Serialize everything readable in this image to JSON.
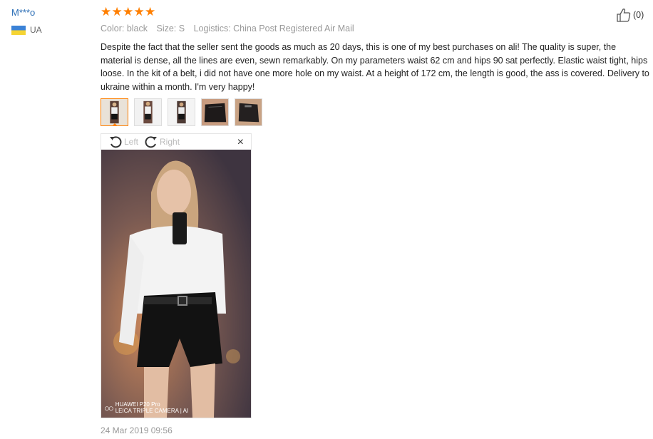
{
  "user": {
    "name": "M***o",
    "country": "UA"
  },
  "rating": {
    "stars": 5,
    "max": 5
  },
  "meta": {
    "color": "Color: black",
    "size": "Size: S",
    "logistics": "Logistics: China Post Registered Air Mail"
  },
  "review": {
    "text": "Despite the fact that the seller sent the goods as much as 20 days, this is one of my best purchases on ali! The quality is super, the material is dense, all the lines are even, sewn remarkably. On my parameters waist 62 cm and hips 90 sat perfectly. Elastic waist tight, hips loose. In the kit of a belt, i did not have one more hole on my waist. At a height of 172 cm, the length is good, the ass is covered. Delivery to ukraine within a month. I'm very happy!"
  },
  "viewer": {
    "rotate_left": "Left",
    "rotate_right": "Right",
    "close": "×",
    "watermark_line1": "HUAWEI P20 Pro",
    "watermark_line2": "LEICA TRIPLE CAMERA | AI"
  },
  "date": "24 Mar 2019 09:56",
  "helpful": {
    "count": "(0)"
  },
  "icons": {
    "star": "star-icon",
    "thumb": "thumbs-up-icon",
    "rotate_left": "rotate-left-icon",
    "rotate_right": "rotate-right-icon",
    "close": "close-icon",
    "flag": "ukraine-flag-icon"
  },
  "colors": {
    "accent": "#ff7f00",
    "username": "#2a6db5"
  }
}
